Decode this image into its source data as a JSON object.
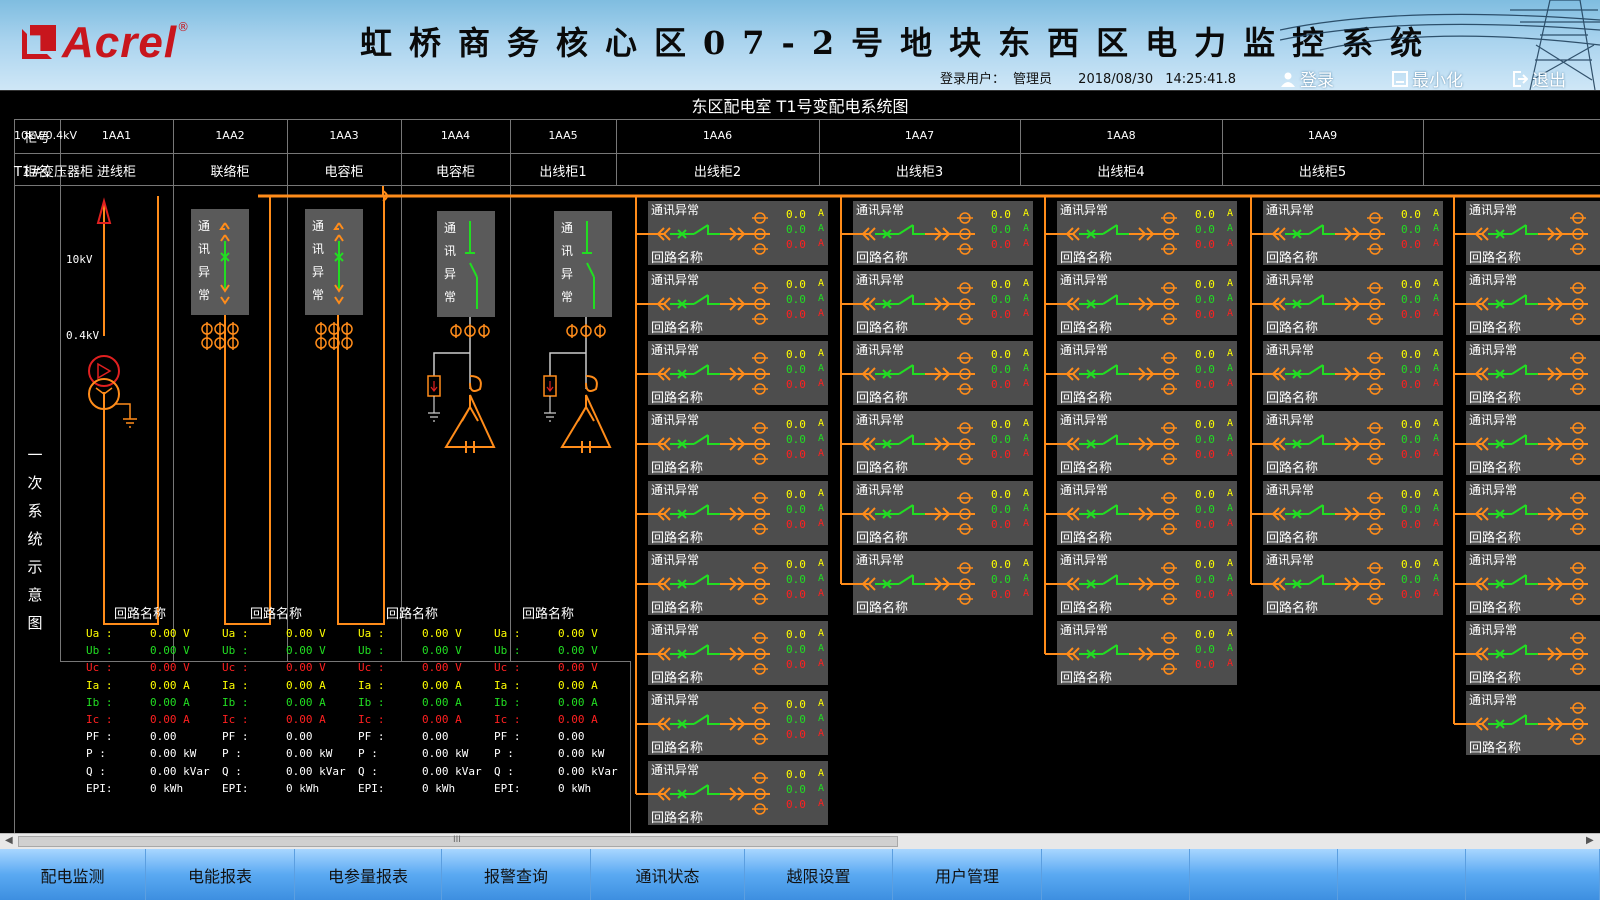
{
  "header": {
    "logo_text": "Acrel",
    "logo_reg": "®",
    "title": "虹桥商务核心区07-2号地块东西区电力监控系统",
    "user_label": "登录用户：",
    "user_name": "管理员",
    "date": "2018/08/30",
    "time": "14:25:41.8",
    "login": "登录",
    "minimize": "最小化",
    "logout": "退出"
  },
  "diagram": {
    "title": "东区配电室 T1号变配电系统图",
    "row_label_id": "柜号",
    "row_label_name": "柜名",
    "vertical_label": "一次系统示意图",
    "columns": [
      {
        "id": "10kV/0.4kV",
        "name": "T1#变压器柜"
      },
      {
        "id": "1AA1",
        "name": "进线柜"
      },
      {
        "id": "1AA2",
        "name": "联络柜"
      },
      {
        "id": "1AA3",
        "name": "电容柜"
      },
      {
        "id": "1AA4",
        "name": "电容柜"
      },
      {
        "id": "1AA5",
        "name": "出线柜1"
      },
      {
        "id": "1AA6",
        "name": "出线柜2"
      },
      {
        "id": "1AA7",
        "name": "出线柜3"
      },
      {
        "id": "1AA8",
        "name": "出线柜4"
      },
      {
        "id": "1AA9",
        "name": "出线柜5"
      }
    ],
    "transformer": {
      "hv": "10kV",
      "lv": "0.4kV"
    },
    "switch_status": "通讯异常",
    "feeder": {
      "status": "通讯异常",
      "name": "回路名称",
      "value": "0.0",
      "unit": "A",
      "counts": [
        9,
        6,
        7,
        6,
        8
      ]
    },
    "colors": {
      "orange": "#ff8c1a",
      "green": "#22dd22",
      "yellow": "#ffff00",
      "red": "#ff2020",
      "panel": "#4d4d4d"
    },
    "meters": [
      {
        "name": "回路名称"
      },
      {
        "name": "回路名称"
      },
      {
        "name": "回路名称"
      },
      {
        "name": "回路名称"
      }
    ],
    "meter_rows": [
      {
        "label": "Ua :",
        "value": "0.00 V",
        "color": "#ffff00"
      },
      {
        "label": "Ub :",
        "value": "0.00 V",
        "color": "#22dd22"
      },
      {
        "label": "Uc :",
        "value": "0.00 V",
        "color": "#ff2020"
      },
      {
        "label": "Ia :",
        "value": "0.00 A",
        "color": "#ffff00"
      },
      {
        "label": "Ib :",
        "value": "0.00 A",
        "color": "#22dd22"
      },
      {
        "label": "Ic :",
        "value": "0.00 A",
        "color": "#ff2020"
      },
      {
        "label": "PF :",
        "value": "0.00",
        "color": "#ffffff"
      },
      {
        "label": "P  :",
        "value": "0.00 kW",
        "color": "#ffffff"
      },
      {
        "label": "Q  :",
        "value": "0.00 kVar",
        "color": "#ffffff"
      },
      {
        "label": "EPI:",
        "value": "0 kWh",
        "color": "#ffffff"
      }
    ]
  },
  "scrollbar": {
    "grip": "III"
  },
  "nav": {
    "items": [
      "配电监测",
      "电能报表",
      "电参量报表",
      "报警查询",
      "通讯状态",
      "越限设置",
      "用户管理",
      "",
      "",
      "",
      ""
    ]
  }
}
